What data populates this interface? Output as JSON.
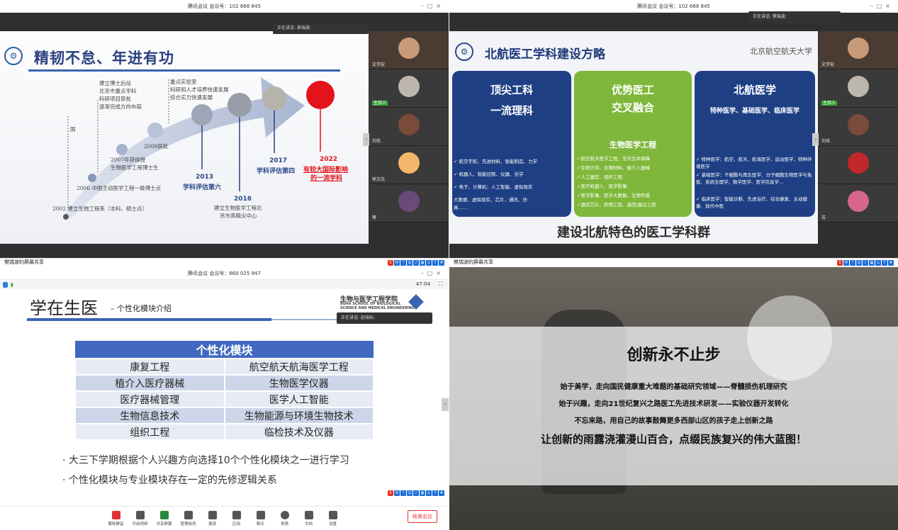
{
  "q1": {
    "title_bar": "腾讯会议 会议号：102 668 845",
    "speaking": "正在讲话: 景瑞波;",
    "slide_title": "精韧不怠、年进有功",
    "milestones": {
      "m2002": "2002  建立生物工程系（本科、硕士点）",
      "m2006": "2006 中国主动医学工程一级博士点",
      "m2007a": "2007年获得授",
      "m2007b": "生物医学工程博士生",
      "m2008": "2008获批",
      "national": "国",
      "block1": "建立博士后站",
      "block1b": "北京市重点学科",
      "block1c": "科研项目获批",
      "block1d": "逐渐完成方向布局",
      "block2": "重点实验室",
      "block2b": "科研和人才培养快速发展",
      "block2c": "综合实力快速发展",
      "y2013": "2013",
      "y2013t": "学科评估第六",
      "y2016": "2016",
      "y2016t": "建立生物医学工程北",
      "y2016t2": "京市高精尖中心",
      "y2017": "2017",
      "y2017t": "学科评估第四",
      "y2022": "2022",
      "y2022t": "有较大国际影响",
      "y2022t2": "的一流学科"
    },
    "bottom_label": "樊瑞波的屏幕共享",
    "participants": [
      "文学宏",
      "主持人",
      "刘伟",
      "徐文志",
      "蒋"
    ]
  },
  "q2": {
    "title_bar": "腾讯会议 会议号：102 668 845",
    "speaking": "正在讲话: 樊瑞波;",
    "slide_title": "北航医工学科建设方略",
    "univ": "北京航空航天大学",
    "left_box": {
      "l1": "顶尖工科",
      "l2": "一流理科"
    },
    "mid_box": {
      "l1": "优势医工",
      "l2": "交叉融合",
      "sub": "生物医学工程"
    },
    "right_box": {
      "l1": "北航医学",
      "l2": "特种医学、基础医学、临床医学"
    },
    "left_items": [
      "✓ 航空宇航、先进材料、智能制造、力学",
      "✓ 机器人、智能控制、仪器、光学",
      "✓ 电子、计算机：人工智能、虚拟现实",
      "   大数据、虚拟现实、芯片、通讯、仿",
      "真……"
    ],
    "mid_items": [
      "✓航空航天医学工程、空天生命保障",
      "✓生物力学、生物材料、植介入器械",
      "✓人工器官、组织工程",
      "✓医疗机器人、医学影像",
      "✓医学影像、医学大数据、生物传感",
      "✓器官芯片、药物工程、基因/蛋白工程"
    ],
    "right_items": [
      "✓ 特种医学：航空、航天、航海医学、运动医学、特种环境医学",
      "✓ 基础医学：干细胞与再生医学、分子细胞生物医学与免疫、系统生理学、数学医学、医学信息学…",
      "✓ 临床医学：智能诊断、先进治疗、综合康复、主动健康、现代中医"
    ],
    "footer": "建设北航特色的医工学科群",
    "bottom_label": "樊瑞波的屏幕共享",
    "participants": [
      "文学宏",
      "主持人",
      "刘伟",
      "",
      "苏"
    ]
  },
  "q3": {
    "title_bar": "腾讯会议 会议号：660 025 947",
    "time": "47:04",
    "speaking": "正在讲话: 赵瑞标;",
    "title": "学在生医",
    "subtitle": "– 个性化模块介绍",
    "school": "生物与医学工程学院",
    "school_en1": "BUAA  SCHOOL OF BIOLOGICAL",
    "school_en2": "SCIENCE AND MEDICAL ENGINEERING",
    "table_header": "个性化模块",
    "rows": [
      [
        "康复工程",
        "航空航天航海医学工程"
      ],
      [
        "植介入医疗器械",
        "生物医学仪器"
      ],
      [
        "医疗器械管理",
        "医学人工智能"
      ],
      [
        "生物信息技术",
        "生物能源与环境生物技术"
      ],
      [
        "组织工程",
        "临检技术及仪器"
      ]
    ],
    "bullet1": "· 大三下学期根据个人兴趣方向选择10个个性化模块之一进行学习",
    "bullet2": "· 个性化模块与专业模块存在一定的先修逻辑关系",
    "toolbar": [
      "解除静音",
      "开启视频",
      "共享屏幕",
      "管理成员",
      "邀请",
      "应用",
      "聊天",
      "表情",
      "文档",
      "设置"
    ],
    "end_button": "结束会议"
  },
  "q4": {
    "heading": "创新永不止步",
    "line1": "始于美学，走向国民健康重大难题的基础研究领域——脊髓损伤机理研究",
    "line2": "始于兴趣，走向21世纪复兴之路医工先进技术研发——实验仪器开发转化",
    "line3": "不忘来路，用自己的故事鼓舞更多西部山区的孩子走上创新之路",
    "line4": "让创新的雨露浇灌漫山百合，点缀民族复兴的伟大蓝图！"
  }
}
